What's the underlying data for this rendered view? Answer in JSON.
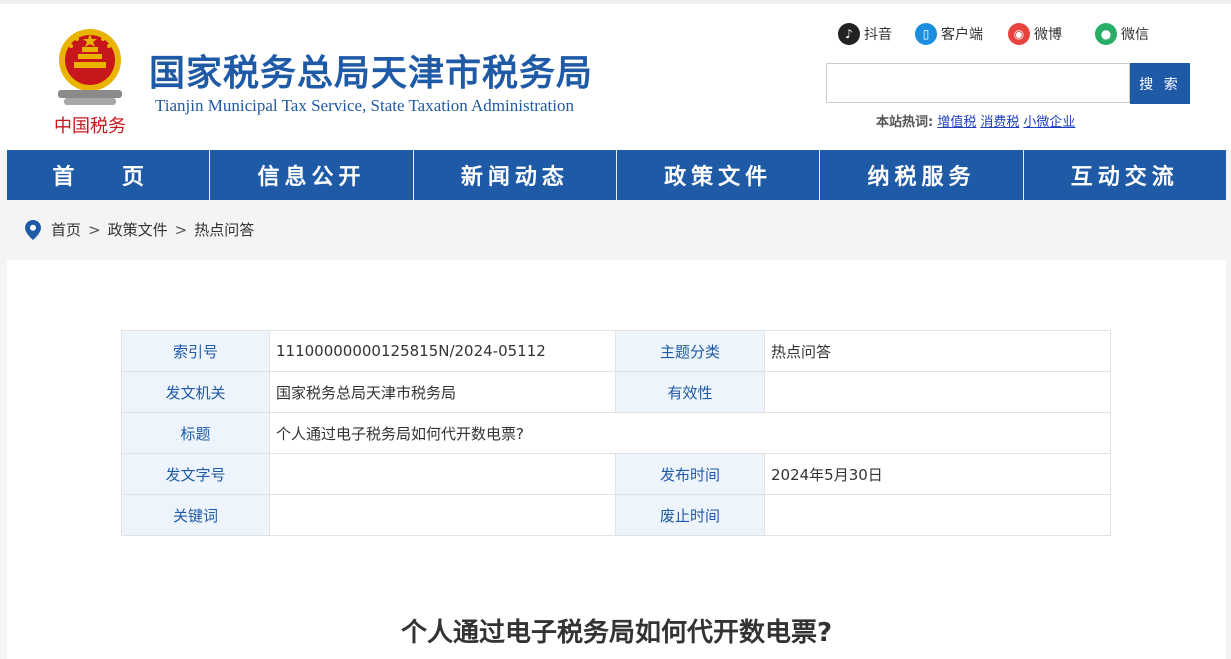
{
  "header": {
    "title": "国家税务总局天津市税务局",
    "subtitle": "Tianjin Municipal Tax Service, State Taxation Administration",
    "emblem_caption": "中国税务",
    "social": [
      {
        "label": "抖音",
        "icon": "douyin-icon",
        "color": "#222222"
      },
      {
        "label": "客户端",
        "icon": "mobile-app-icon",
        "color": "#1a8fe0"
      },
      {
        "label": "微博",
        "icon": "weibo-icon",
        "color": "#e8433e"
      },
      {
        "label": "微信",
        "icon": "wechat-icon",
        "color": "#2aae67"
      }
    ],
    "search": {
      "placeholder": "",
      "button": "搜 索"
    },
    "hot": {
      "label": "本站热词:",
      "terms": [
        "增值税",
        "消费税",
        "小微企业"
      ]
    }
  },
  "nav": [
    "首 页",
    "信息公开",
    "新闻动态",
    "政策文件",
    "纳税服务",
    "互动交流"
  ],
  "breadcrumb": {
    "items": [
      "首页",
      "政策文件",
      "热点问答"
    ],
    "separator": ">"
  },
  "meta": {
    "index_no_label": "索引号",
    "index_no": "11100000000125815N/2024-05112",
    "topic_label": "主题分类",
    "topic": "热点问答",
    "issuer_label": "发文机关",
    "issuer": "国家税务总局天津市税务局",
    "validity_label": "有效性",
    "validity": "",
    "title_label": "标题",
    "title": "个人通过电子税务局如何代开数电票?",
    "doc_no_label": "发文字号",
    "doc_no": "",
    "publish_label": "发布时间",
    "publish": "2024年5月30日",
    "keywords_label": "关键词",
    "keywords": "",
    "expire_label": "废止时间",
    "expire": ""
  },
  "article": {
    "title": "个人通过电子税务局如何代开数电票?"
  },
  "colors": {
    "brand": "#1f5aa6",
    "label_bg": "#eef4fb",
    "emblem_red": "#c8161d",
    "emblem_gold": "#e8b400"
  }
}
